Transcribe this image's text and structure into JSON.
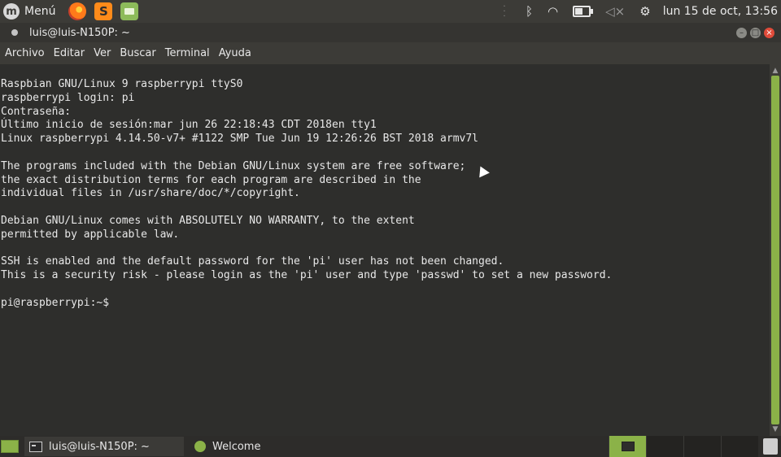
{
  "top_panel": {
    "menu_label": "Menú",
    "clock": "lun 15 de oct, 13:56"
  },
  "window": {
    "title": "luis@luis-N150P: ~",
    "menu": [
      "Archivo",
      "Editar",
      "Ver",
      "Buscar",
      "Terminal",
      "Ayuda"
    ]
  },
  "terminal": {
    "text": "Raspbian GNU/Linux 9 raspberrypi ttyS0\nraspberrypi login: pi\nContraseña:\nÚltimo inicio de sesión:mar jun 26 22:18:43 CDT 2018en tty1\nLinux raspberrypi 4.14.50-v7+ #1122 SMP Tue Jun 19 12:26:26 BST 2018 armv7l\n\nThe programs included with the Debian GNU/Linux system are free software;\nthe exact distribution terms for each program are described in the\nindividual files in /usr/share/doc/*/copyright.\n\nDebian GNU/Linux comes with ABSOLUTELY NO WARRANTY, to the extent\npermitted by applicable law.\n\nSSH is enabled and the default password for the 'pi' user has not been changed.\nThis is a security risk - please login as the 'pi' user and type 'passwd' to set a new password.\n\npi@raspberrypi:~$"
  },
  "taskbar": {
    "tasks": [
      {
        "label": "luis@luis-N150P: ~"
      },
      {
        "label": "Welcome"
      }
    ]
  },
  "colors": {
    "accent": "#8bb248",
    "panel": "#3c3b37",
    "terminal_bg": "#2e2e2c",
    "close": "#e04b3a"
  },
  "icons": {
    "menu": "mint-logo-icon",
    "launchers": [
      "firefox-icon",
      "sublime-text-icon",
      "files-icon"
    ],
    "tray": [
      "bluetooth-icon",
      "wifi-icon",
      "battery-icon",
      "volume-muted-icon",
      "settings-icon"
    ]
  }
}
